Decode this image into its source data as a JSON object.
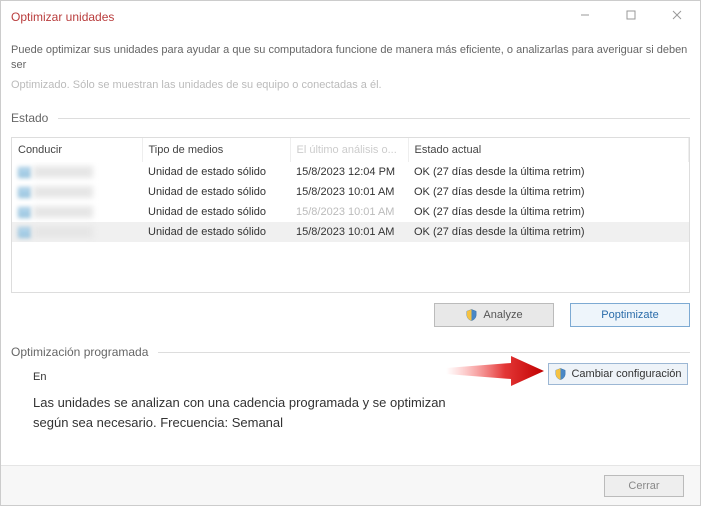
{
  "window": {
    "title": "Optimizar unidades",
    "description": "Puede optimizar sus unidades para ayudar a que su computadora funcione de manera más eficiente, o analizarlas para averiguar si deben ser",
    "description_sub": "Optimizado. Sólo se muestran las unidades de su equipo o conectadas a él."
  },
  "section_estado": "Estado",
  "columns": {
    "drive": "Conducir",
    "media": "Tipo de medios",
    "analysis": "El último análisis o...",
    "status": "Estado actual"
  },
  "rows": [
    {
      "media": "Unidad de estado sólido",
      "analysis": "15/8/2023 12:04 PM",
      "status": "OK (27 días desde la última retrim)",
      "selected": false
    },
    {
      "media": "Unidad de estado sólido",
      "analysis": "15/8/2023 10:01 AM",
      "status": "OK (27 días desde la última retrim)",
      "selected": false
    },
    {
      "media": "Unidad de estado sólido",
      "analysis": "15/8/2023 10:01 AM",
      "status": "OK (27 días desde la última retrim)",
      "selected": false,
      "dim_analysis": true
    },
    {
      "media": "Unidad de estado sólido",
      "analysis": "15/8/2023 10:01 AM",
      "status": "OK (27 días desde la última retrim)",
      "selected": true
    }
  ],
  "buttons": {
    "analyze": "Analyze",
    "optimize": "Poptimizate",
    "change": "Cambiar configuración",
    "close": "Cerrar"
  },
  "section_schedule": "Optimización programada",
  "schedule": {
    "on_label": "En",
    "text": "Las unidades se analizan con una cadencia programada y se optimizan según sea necesario. Frecuencia: Semanal"
  }
}
